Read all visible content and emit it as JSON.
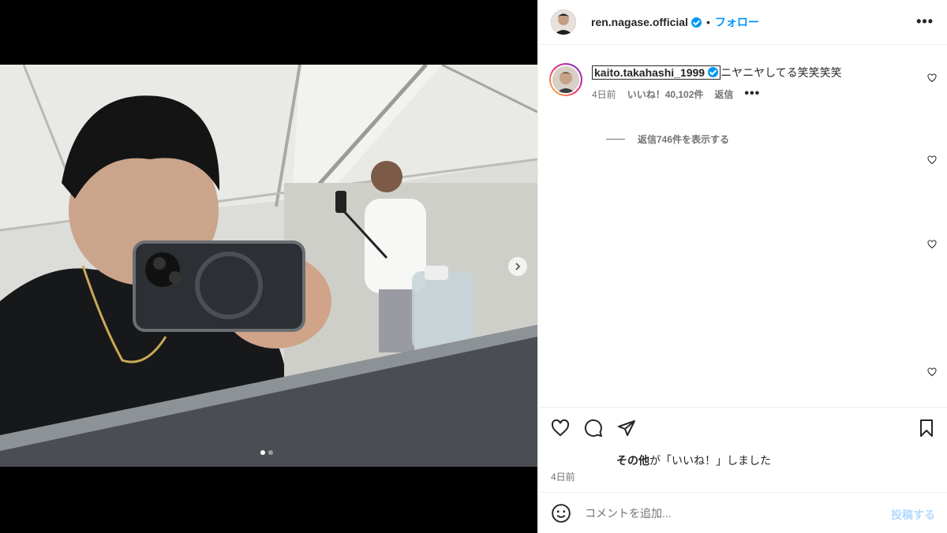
{
  "post": {
    "author": "ren.nagase.official",
    "separator": "•",
    "follow_label": "フォロー",
    "more_label": "•••"
  },
  "media": {
    "current_slide": 1,
    "total_slides": 2,
    "next_label": "›"
  },
  "comment": {
    "username": "kaito.takahashi_1999",
    "text": "ニヤニヤしてる笑笑笑笑",
    "time": "4日前",
    "likes": "いいね！40,102件",
    "reply_label": "返信",
    "more_label": "•••",
    "view_replies": "返信746件を表示する"
  },
  "engagement": {
    "liked_by_bold": "その他",
    "liked_by_rest": "が「いいね！」しました",
    "date": "4日前"
  },
  "composer": {
    "placeholder": "コメントを追加...",
    "post_label": "投稿する"
  },
  "colors": {
    "accent": "#0095f6",
    "text": "#262626",
    "muted": "#737373",
    "border": "#efefef"
  }
}
